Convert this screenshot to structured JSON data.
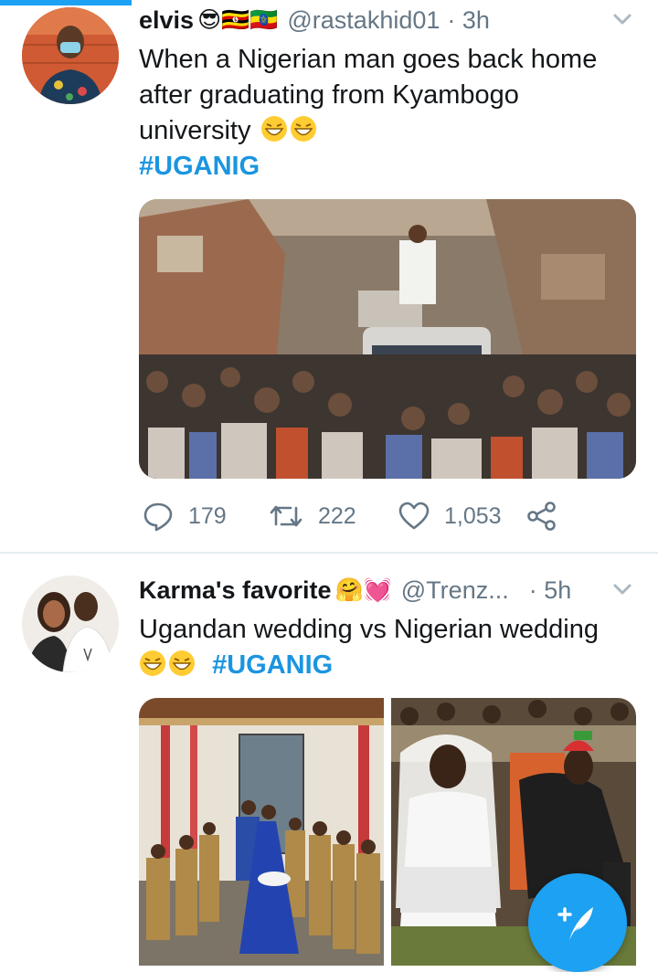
{
  "tweets": [
    {
      "name": "elvis",
      "name_emoji": "😎🇺🇬🇪🇹",
      "handle": "@rastakhid01",
      "time": "· 3h",
      "text_line1": "When a Nigerian man goes back home",
      "text_line2": "after graduating from Kyambogo",
      "text_line3": "university",
      "hashtag": "#UGANIG",
      "replies": "179",
      "retweets": "222",
      "likes": "1,053",
      "media_description": "photo-crowd-on-street"
    },
    {
      "name": "Karma's favorite",
      "name_emoji": "🤗💓",
      "handle": "@Trenz...",
      "time": "· 5h",
      "text_line1": "Ugandan wedding vs Nigerian wedding",
      "hashtag": "#UGANIG",
      "media_description": "photo-wedding-comparison"
    }
  ],
  "colors": {
    "accent": "#1da1f2",
    "hashtag": "#1b95e0",
    "secondary_text": "#657786",
    "divider": "#e6ecf0"
  },
  "icons": [
    "reply-icon",
    "retweet-icon",
    "like-icon",
    "share-icon",
    "chevron-down-icon",
    "compose-tweet-icon"
  ]
}
